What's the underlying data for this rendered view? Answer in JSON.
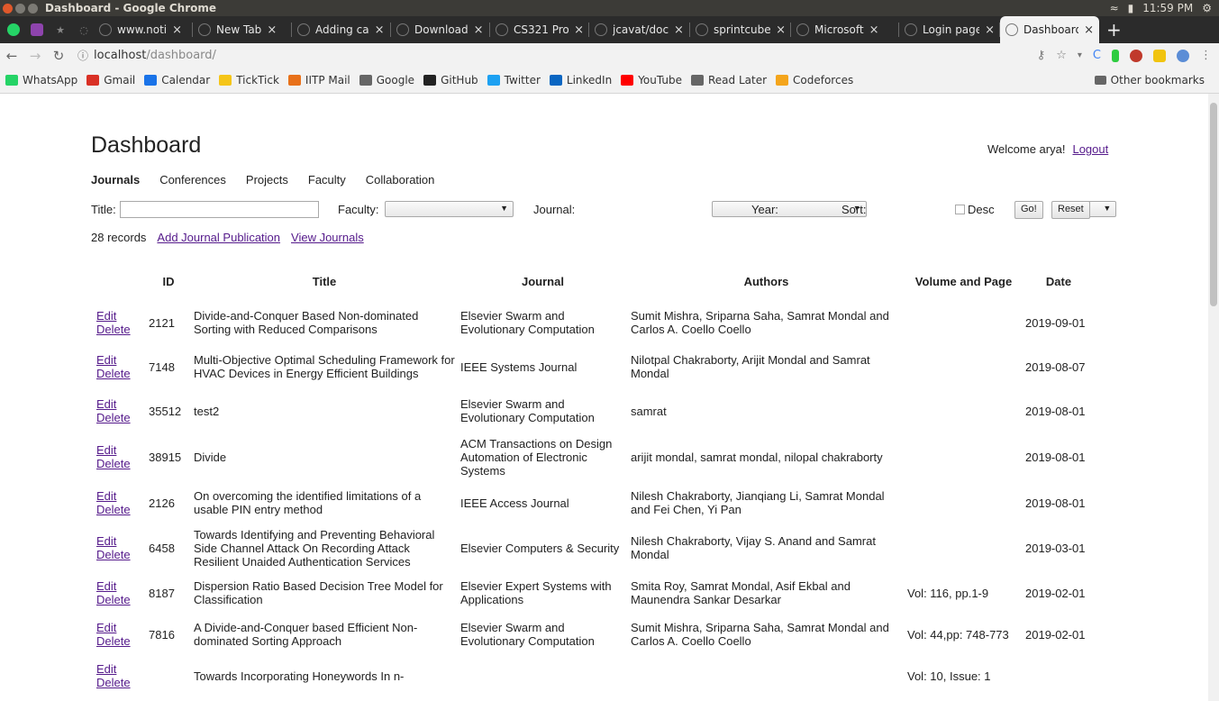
{
  "os": {
    "window_title": "Dashboard - Google Chrome",
    "clock": "11:59 PM"
  },
  "browser": {
    "tabs": [
      {
        "label": "www.noti",
        "favicon": "notion-icon"
      },
      {
        "label": "New Tab",
        "favicon": "blank-icon"
      },
      {
        "label": "Adding ca",
        "favicon": "loading-icon"
      },
      {
        "label": "Download",
        "favicon": "loading-icon"
      },
      {
        "label": "CS321 Pro",
        "favicon": "loading-icon"
      },
      {
        "label": "jcavat/doc",
        "favicon": "github-icon"
      },
      {
        "label": "sprintcube",
        "favicon": "github-icon"
      },
      {
        "label": "Microsoft",
        "favicon": "loading-icon"
      },
      {
        "label": "Login page",
        "favicon": "loading-icon"
      },
      {
        "label": "Dashboard",
        "favicon": "globe-icon",
        "active": true
      }
    ],
    "url_host": "localhost",
    "url_path": "/dashboard/",
    "bookmarks": [
      {
        "label": "WhatsApp",
        "color": "#25d366"
      },
      {
        "label": "Gmail",
        "color": "#d93025"
      },
      {
        "label": "Calendar",
        "color": "#1a73e8"
      },
      {
        "label": "TickTick",
        "color": "#f5c518"
      },
      {
        "label": "IITP Mail",
        "color": "#e8711a"
      },
      {
        "label": "Google",
        "color": "#666666"
      },
      {
        "label": "GitHub",
        "color": "#222222"
      },
      {
        "label": "Twitter",
        "color": "#1da1f2"
      },
      {
        "label": "LinkedIn",
        "color": "#0a66c2"
      },
      {
        "label": "YouTube",
        "color": "#ff0000"
      },
      {
        "label": "Read Later",
        "color": "#666666"
      },
      {
        "label": "Codeforces",
        "color": "#f4a51c"
      }
    ],
    "other_bookmarks": "Other bookmarks"
  },
  "header": {
    "title": "Dashboard",
    "welcome": "Welcome arya!",
    "logout": "Logout"
  },
  "nav": [
    "Journals",
    "Conferences",
    "Projects",
    "Faculty",
    "Collaboration"
  ],
  "filters": {
    "title_label": "Title:",
    "title_value": "",
    "faculty_label": "Faculty:",
    "journal_label": "Journal:",
    "year_label": "Year:",
    "sort_label": "Sort:",
    "desc_label": "Desc",
    "go_label": "Go!",
    "reset_label": "Reset"
  },
  "records": {
    "count": "28 records",
    "add_link": "Add Journal Publication",
    "view_link": "View Journals"
  },
  "table": {
    "headers": [
      "ID",
      "Title",
      "Journal",
      "Authors",
      "Volume and Page",
      "Date"
    ],
    "edit_label": "Edit",
    "delete_label": "Delete",
    "rows": [
      {
        "id": "2121",
        "title": "Divide-and-Conquer Based Non-dominated Sorting with Reduced Comparisons",
        "journal": "Elsevier Swarm and Evolutionary Computation",
        "authors": "Sumit Mishra, Sriparna Saha, Samrat Mondal and Carlos A. Coello Coello",
        "volume": "",
        "date": "2019-09-01"
      },
      {
        "id": "7148",
        "title": "Multi-Objective Optimal Scheduling Framework for HVAC Devices in Energy Efficient Buildings",
        "journal": "IEEE Systems Journal",
        "authors": "Nilotpal Chakraborty, Arijit Mondal and Samrat Mondal",
        "volume": "",
        "date": "2019-08-07"
      },
      {
        "id": "35512",
        "title": "test2",
        "journal": "Elsevier Swarm and Evolutionary Computation",
        "authors": "samrat",
        "volume": "",
        "date": "2019-08-01"
      },
      {
        "id": "38915",
        "title": "Divide",
        "journal": "ACM Transactions on Design Automation of Electronic Systems",
        "authors": "arijit mondal, samrat mondal, nilopal chakraborty",
        "volume": "",
        "date": "2019-08-01"
      },
      {
        "id": "2126",
        "title": "On overcoming the identified limitations of a usable PIN entry method",
        "journal": "IEEE Access Journal",
        "authors": "Nilesh Chakraborty, Jianqiang Li, Samrat Mondal and Fei Chen, Yi Pan",
        "volume": "",
        "date": "2019-08-01"
      },
      {
        "id": "6458",
        "title": "Towards Identifying and Preventing Behavioral Side Channel Attack On Recording Attack Resilient Unaided Authentication Services",
        "journal": "Elsevier Computers & Security",
        "authors": "Nilesh Chakraborty, Vijay S. Anand and Samrat Mondal",
        "volume": "",
        "date": "2019-03-01"
      },
      {
        "id": "8187",
        "title": "Dispersion Ratio Based Decision Tree Model for Classification",
        "journal": "Elsevier Expert Systems with Applications",
        "authors": "Smita Roy, Samrat Mondal, Asif Ekbal and Maunendra Sankar Desarkar",
        "volume": "Vol: 116, pp.1-9",
        "date": "2019-02-01"
      },
      {
        "id": "7816",
        "title": "A Divide-and-Conquer based Efficient Non-dominated Sorting Approach",
        "journal": "Elsevier Swarm and Evolutionary Computation",
        "authors": "Sumit Mishra, Sriparna Saha, Samrat Mondal and Carlos A. Coello Coello",
        "volume": "Vol: 44,pp: 748-773",
        "date": "2019-02-01"
      },
      {
        "id": "",
        "title": "Towards Incorporating Honeywords In n-",
        "journal": "",
        "authors": "",
        "volume": "Vol: 10, Issue: 1",
        "date": ""
      }
    ]
  }
}
